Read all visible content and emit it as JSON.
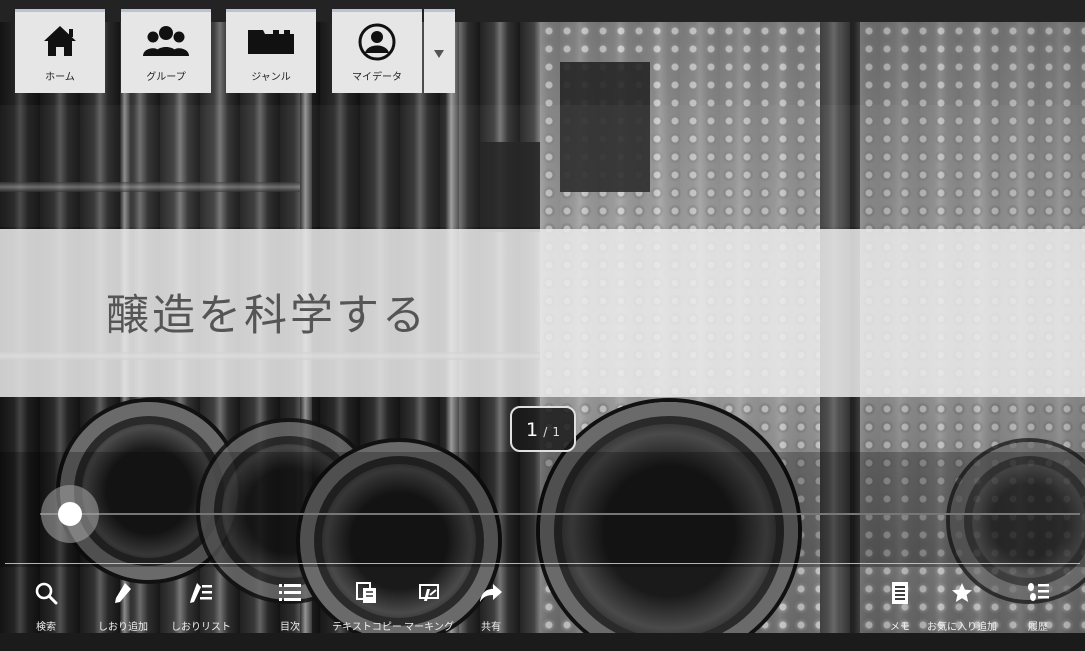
{
  "nav": {
    "items": [
      {
        "label": "ホーム",
        "icon": "home-icon"
      },
      {
        "label": "グループ",
        "icon": "group-icon"
      },
      {
        "label": "ジャンル",
        "icon": "genre-icon"
      },
      {
        "label": "マイデータ",
        "icon": "mydata-icon"
      }
    ],
    "dropdown_icon": "dropdown-arrow-icon"
  },
  "book": {
    "title": "醸造を科学する"
  },
  "pager": {
    "current": "1",
    "total": "1",
    "separator": "/"
  },
  "slider": {
    "position_fraction": 0.0
  },
  "toolbar": {
    "items": [
      {
        "label": "検索",
        "icon": "search-icon"
      },
      {
        "label": "しおり追加",
        "icon": "bookmark-add-icon"
      },
      {
        "label": "しおりリスト",
        "icon": "bookmark-list-icon"
      },
      {
        "label": "目次",
        "icon": "toc-icon"
      },
      {
        "label": "テキストコピー",
        "icon": "text-copy-icon"
      },
      {
        "label": "マーキング",
        "icon": "marking-icon"
      },
      {
        "label": "共有",
        "icon": "share-icon"
      },
      {
        "label": "メモ",
        "icon": "memo-icon"
      },
      {
        "label": "お気に入り追加",
        "icon": "favorite-add-icon"
      },
      {
        "label": "履歴",
        "icon": "history-icon"
      }
    ]
  },
  "colors": {
    "nav_button_bg": "#e6e6e6",
    "nav_top_border": "#b8c3d3",
    "title_band": "#ebebeb",
    "title_text": "#555555",
    "toolbar_text": "#f0f0f0"
  }
}
